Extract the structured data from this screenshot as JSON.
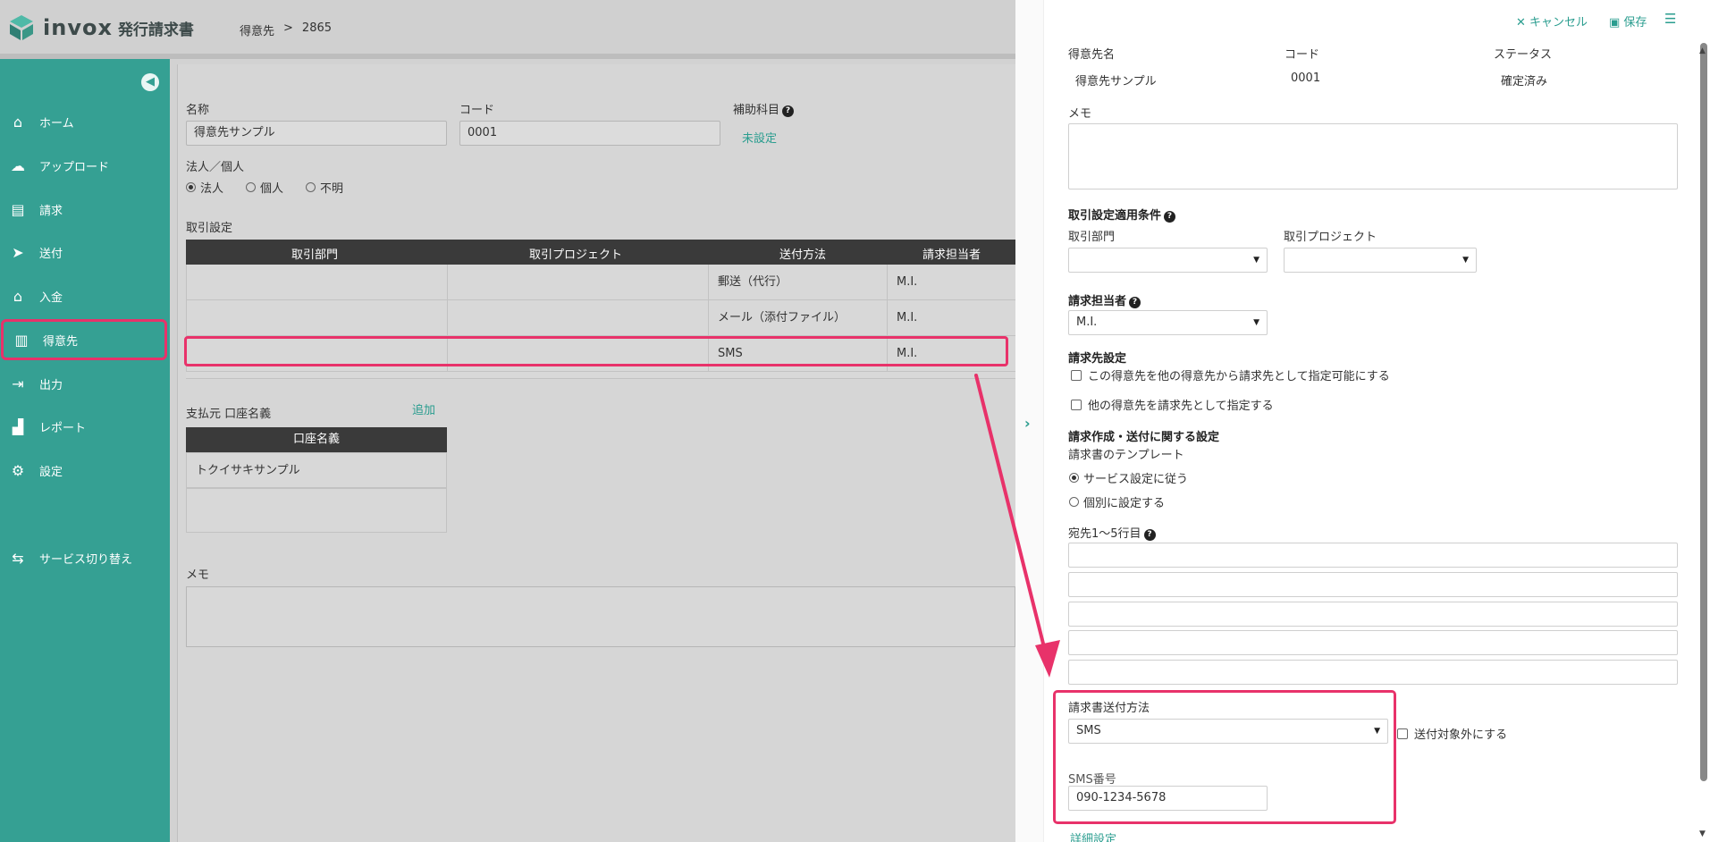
{
  "app": {
    "logo_word": "invox",
    "logo_sub": "発行請求書",
    "breadcrumb": {
      "section": "得意先",
      "separator": ">",
      "id": "2865"
    }
  },
  "sidebar": {
    "items": [
      {
        "label": "ホーム",
        "icon": "home-icon",
        "glyph": "⌂"
      },
      {
        "label": "アップロード",
        "icon": "cloud-upload-icon",
        "glyph": "☁"
      },
      {
        "label": "請求",
        "icon": "document-icon",
        "glyph": "▤"
      },
      {
        "label": "送付",
        "icon": "paper-plane-icon",
        "glyph": "➤"
      },
      {
        "label": "入金",
        "icon": "bank-icon",
        "glyph": "⌂"
      },
      {
        "label": "得意先",
        "icon": "building-icon",
        "glyph": "▥"
      },
      {
        "label": "出力",
        "icon": "export-icon",
        "glyph": "⇥"
      },
      {
        "label": "レポート",
        "icon": "bar-chart-icon",
        "glyph": "▟"
      },
      {
        "label": "設定",
        "icon": "gear-icon",
        "glyph": "⚙"
      },
      {
        "label": "サービス切り替え",
        "icon": "switch-icon",
        "glyph": "⇆"
      }
    ],
    "active": "得意先"
  },
  "main": {
    "name_label": "名称",
    "name_value": "得意先サンプル",
    "code_label": "コード",
    "code_value": "0001",
    "sub_account_label": "補助科目",
    "sub_account_value": "未設定",
    "entity_label": "法人／個人",
    "entity_options": [
      "法人",
      "個人",
      "不明"
    ],
    "entity_selected": "法人",
    "trade_label": "取引設定",
    "trade_columns": [
      "取引部門",
      "取引プロジェクト",
      "送付方法",
      "請求担当者"
    ],
    "trade_rows": [
      {
        "dept": "",
        "project": "",
        "method": "郵送（代行）",
        "person": "M.I."
      },
      {
        "dept": "",
        "project": "",
        "method": "メール（添付ファイル）",
        "person": "M.I."
      },
      {
        "dept": "",
        "project": "",
        "method": "SMS",
        "person": "M.I."
      }
    ],
    "payer_label": "支払元 口座名義",
    "payer_add": "追加",
    "account_column": "口座名義",
    "account_rows": [
      "トクイサキサンプル",
      ""
    ],
    "memo_label": "メモ"
  },
  "panel": {
    "cancel_label": "キャンセル",
    "save_label": "保存",
    "customer_name_label": "得意先名",
    "customer_name_value": "得意先サンプル",
    "code_label": "コード",
    "code_value": "0001",
    "status_label": "ステータス",
    "status_value": "確定済み",
    "memo_label": "メモ",
    "trade_cond_label": "取引設定適用条件",
    "dept_label": "取引部門",
    "project_label": "取引プロジェクト",
    "person_label": "請求担当者",
    "person_value": "M.I.",
    "billing_dest_label": "請求先設定",
    "billing_dest_opt1": "この得意先を他の得意先から請求先として指定可能にする",
    "billing_dest_opt2": "他の得意先を請求先として指定する",
    "creation_label": "請求作成・送付に関する設定",
    "template_label": "請求書のテンプレート",
    "template_options": [
      "サービス設定に従う",
      "個別に設定する"
    ],
    "template_selected": "サービス設定に従う",
    "address_label": "宛先1〜5行目",
    "address_lines": [
      "",
      "",
      "",
      "",
      ""
    ],
    "send_method_label": "請求書送付方法",
    "send_method_value": "SMS",
    "exclude_label": "送付対象外にする",
    "sms_number_label": "SMS番号",
    "sms_number_value": "090-1234-5678",
    "detail_link": "詳細設定"
  },
  "colors": {
    "sidebar": "#35a093",
    "accent": "#2a9d8f",
    "highlight": "#e8326a",
    "table_header": "#3a3a3a"
  }
}
